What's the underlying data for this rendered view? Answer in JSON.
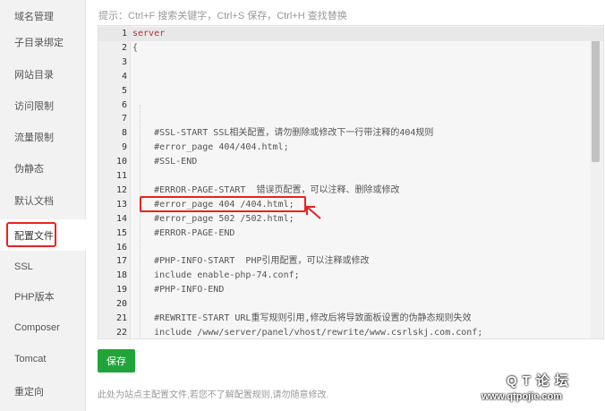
{
  "sidebar": {
    "items": [
      {
        "label": "域名管理"
      },
      {
        "label": "子目录绑定"
      },
      {
        "label": "网站目录"
      },
      {
        "label": "访问限制"
      },
      {
        "label": "流量限制"
      },
      {
        "label": "伪静态"
      },
      {
        "label": "默认文档"
      },
      {
        "label": "配置文件"
      },
      {
        "label": "SSL"
      },
      {
        "label": "PHP版本"
      },
      {
        "label": "Composer"
      },
      {
        "label": "Tomcat"
      },
      {
        "label": "重定向"
      }
    ],
    "active_index": 7
  },
  "hint": "提示：Ctrl+F 搜索关键字，Ctrl+S 保存，Ctrl+H 查找替换",
  "editor": {
    "lines": [
      {
        "n": "1",
        "text": "server",
        "type": "kw"
      },
      {
        "n": "2",
        "text": "{",
        "type": "cm"
      },
      {
        "n": "3",
        "text": "",
        "type": "cm"
      },
      {
        "n": "4",
        "text": "",
        "type": "cm"
      },
      {
        "n": "5",
        "text": "",
        "type": "cm"
      },
      {
        "n": "6",
        "text": "",
        "type": "cm"
      },
      {
        "n": "7",
        "text": "",
        "type": "cm"
      },
      {
        "n": "8",
        "text": "    #SSL-START SSL相关配置，请勿删除或修改下一行带注释的404规则",
        "type": "cm"
      },
      {
        "n": "9",
        "text": "    #error_page 404/404.html;",
        "type": "cm"
      },
      {
        "n": "10",
        "text": "    #SSL-END",
        "type": "cm"
      },
      {
        "n": "11",
        "text": "",
        "type": "cm"
      },
      {
        "n": "12",
        "text": "    #ERROR-PAGE-START  错误页配置，可以注释、删除或修改",
        "type": "cm"
      },
      {
        "n": "13",
        "text": "    #error_page 404 /404.html;",
        "type": "cm"
      },
      {
        "n": "14",
        "text": "    #error_page 502 /502.html;",
        "type": "cm"
      },
      {
        "n": "15",
        "text": "    #ERROR-PAGE-END",
        "type": "cm"
      },
      {
        "n": "16",
        "text": "",
        "type": "cm"
      },
      {
        "n": "17",
        "text": "    #PHP-INFO-START  PHP引用配置，可以注释或修改",
        "type": "cm"
      },
      {
        "n": "18",
        "text": "    include enable-php-74.conf;",
        "type": "cm"
      },
      {
        "n": "19",
        "text": "    #PHP-INFO-END",
        "type": "cm"
      },
      {
        "n": "20",
        "text": "",
        "type": "cm"
      },
      {
        "n": "21",
        "text": "    #REWRITE-START URL重写规则引用,修改后将导致面板设置的伪静态规则失效",
        "type": "cm"
      },
      {
        "n": "22",
        "text": "    include /www/server/panel/vhost/rewrite/www.csrlskj.com.conf;",
        "type": "cm"
      }
    ],
    "active_line": 1
  },
  "save_label": "保存",
  "foot_note": "此处为站点主配置文件,若您不了解配置规则,请勿随意修改.",
  "watermark": {
    "line1": "QT论坛",
    "line2": "www.qtpojie.com"
  },
  "colors": {
    "accent": "#20a53a",
    "highlight": "#e8221f"
  }
}
